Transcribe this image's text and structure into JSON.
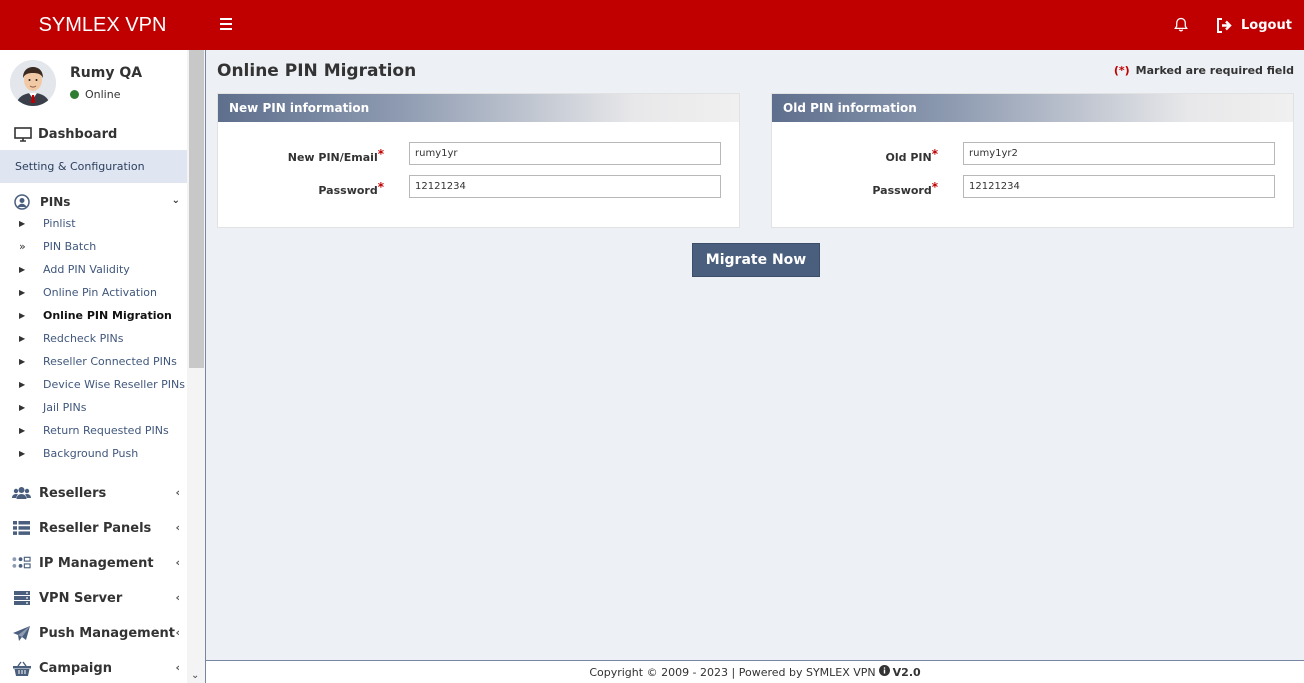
{
  "header": {
    "brand": "SYMLEX VPN",
    "logout_label": "Logout"
  },
  "user": {
    "name": "Rumy QA",
    "status": "Online"
  },
  "sidebar": {
    "dashboard": "Dashboard",
    "section_header": "Setting & Configuration",
    "pins_label": "PINs",
    "pin_items": [
      "Pinlist",
      "PIN Batch",
      "Add PIN Validity",
      "Online Pin Activation",
      "Online PIN Migration",
      "Redcheck PINs",
      "Reseller Connected PINs",
      "Device Wise Reseller PINs",
      "Jail PINs",
      "Return Requested PINs",
      "Background Push"
    ],
    "active_item": "Online PIN Migration",
    "main_items": [
      {
        "label": "Resellers",
        "icon": "users-icon"
      },
      {
        "label": "Reseller Panels",
        "icon": "list-icon"
      },
      {
        "label": "IP Management",
        "icon": "network-icon"
      },
      {
        "label": "VPN Server",
        "icon": "server-icon"
      },
      {
        "label": "Push Management",
        "icon": "paper-plane-icon"
      },
      {
        "label": "Campaign",
        "icon": "basket-icon"
      }
    ]
  },
  "page": {
    "title": "Online PIN Migration",
    "required_marker": "(*)",
    "required_text": "Marked are required field"
  },
  "new_pin": {
    "heading": "New PIN information",
    "pin_label": "New PIN/Email",
    "pin_value": "rumy1yr",
    "password_label": "Password",
    "password_value": "12121234"
  },
  "old_pin": {
    "heading": "Old PIN information",
    "pin_label": "Old PIN",
    "pin_value": "rumy1yr2",
    "password_label": "Password",
    "password_value": "12121234"
  },
  "actions": {
    "migrate_label": "Migrate Now"
  },
  "footer": {
    "copyright": "Copyright © 2009 - 2023 | Powered by SYMLEX VPN",
    "version": "V2.0"
  },
  "colors": {
    "header_red": "#c00000",
    "button": "#4a5f7e",
    "link": "#40577c",
    "status_online": "#2f7d32"
  }
}
